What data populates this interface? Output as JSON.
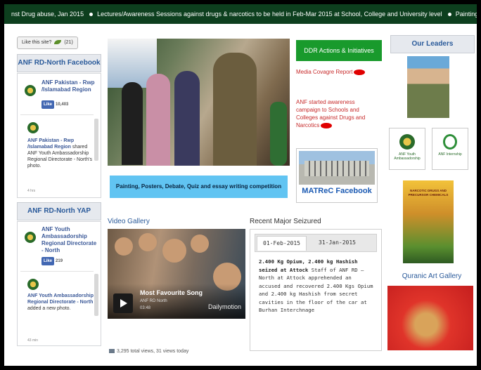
{
  "ticker": {
    "items": [
      "nst Drug abuse, Jan 2015",
      "Lectures/Awareness Sessions against drugs & narcotics to be held in Feb-Mar 2015 at School, College and University level",
      "Paintings"
    ]
  },
  "like_site": {
    "label": "Like this site?",
    "count": "(21)"
  },
  "fb1": {
    "title": "ANF RD-North Facebook",
    "page_name": "ANF Pakistan - Rwp /Islamabad Region",
    "like": "Like",
    "likes": "10,403",
    "post_name": "ANF Pakistan - Rwp /Islamabad Region",
    "post_text": "shared ANF Youth Ambassadorship Regional Directorate - North's photo.",
    "post_time": "4 hrs"
  },
  "fb2": {
    "title": "ANF RD-North YAP Facebook",
    "page_name": "ANF Youth Ambassadorship Regional Directorate - North",
    "like": "Like",
    "likes": "219",
    "post_name": "ANF Youth Ambassadorship Regional Directorate - North",
    "post_text": "added a new photo.",
    "post_time": "43 min"
  },
  "banner": "Painting, Posters, Debate, Quiz and essay writing competition",
  "video": {
    "section": "Video Gallery",
    "title": "Most Favourite Song",
    "channel": "ANF RD North",
    "duration": "03:48",
    "brand": "Dailymotion"
  },
  "views": "3,295 total views, 31 views today",
  "seized": {
    "section": "Recent Major Seizured",
    "tabs": [
      "01-Feb-2015",
      "31-Jan-2015"
    ],
    "headline": "2.400 Kg Opium, 2.400 kg Hashish seized at Attock",
    "body": "Staff of ANF RD – North at Attock apprehended an accused and recovered 2.400 Kgs Opium and 2.400 kg Hashish from secret cavities in the floor of the car at Burhan Interchnage"
  },
  "ddr": {
    "button": "DDR Actions & Initiatives",
    "link1": "Media Covagre Report",
    "link2": "ANF started awareness campaign to Schools and Colleges against Drugs and Narcotics"
  },
  "matrec": "MATReC Facebook",
  "leaders": {
    "title": "Our Leaders",
    "tile1": "ANF Youth Ambassadorship",
    "tile2": "ANF Internship"
  },
  "book_title": "NARCOTIC DRUGS AND PRECURSOR CHEMICALS",
  "quranic": "Quranic Art Gallery"
}
